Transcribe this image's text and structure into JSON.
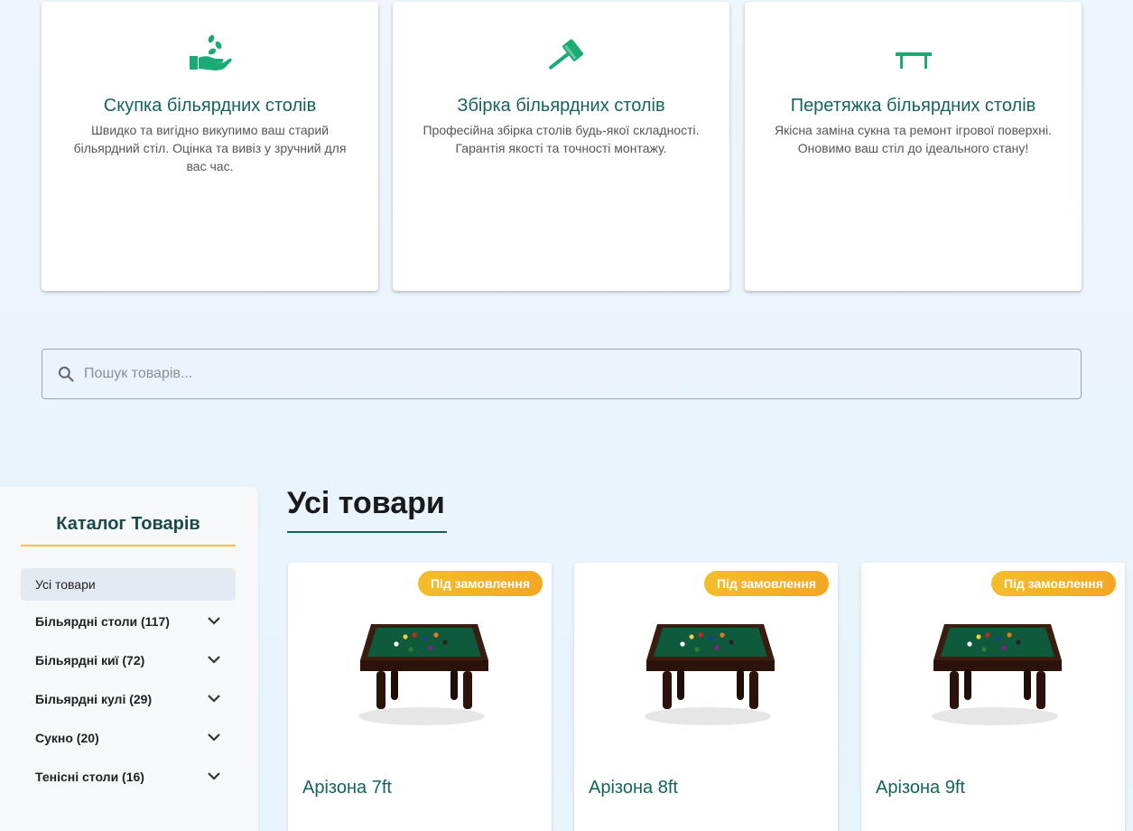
{
  "services": [
    {
      "title": "Скупка більярдних столів",
      "description": "Швидко та вигідно викупимо ваш старий більярдний стіл. Оцінка та вивіз у зручний для вас час.",
      "icon": "hand-seeds-icon"
    },
    {
      "title": "Збірка більярдних столів",
      "description": "Професійна збірка столів будь-якої складності. Гарантія якості та точності монтажу.",
      "icon": "hammer-icon"
    },
    {
      "title": "Перетяжка більярдних столів",
      "description": "Якісна заміна сукна та ремонт ігрової поверхні. Оновимо ваш стіл до ідеального стану!",
      "icon": "table-icon"
    }
  ],
  "search": {
    "placeholder": "Пошук товарів..."
  },
  "sidebar": {
    "title": "Каталог Товарів",
    "all_label": "Усі товари",
    "categories": [
      {
        "label": "Більярдні столи (117)"
      },
      {
        "label": "Більярдні киї (72)"
      },
      {
        "label": "Більярдні кулі (29)"
      },
      {
        "label": "Сукно (20)"
      },
      {
        "label": "Тенісні столи (16)"
      }
    ]
  },
  "main": {
    "title": "Усі товари",
    "products": [
      {
        "name": "Арізона 7ft",
        "badge": "Під замовлення"
      },
      {
        "name": "Арізона 8ft",
        "badge": "Під замовлення"
      },
      {
        "name": "Арізона 9ft",
        "badge": "Під замовлення"
      }
    ]
  },
  "colors": {
    "accent": "#146459",
    "icon_green": "#1aaa73",
    "badge": "#f5a623",
    "underline_yellow": "#f2c230"
  }
}
